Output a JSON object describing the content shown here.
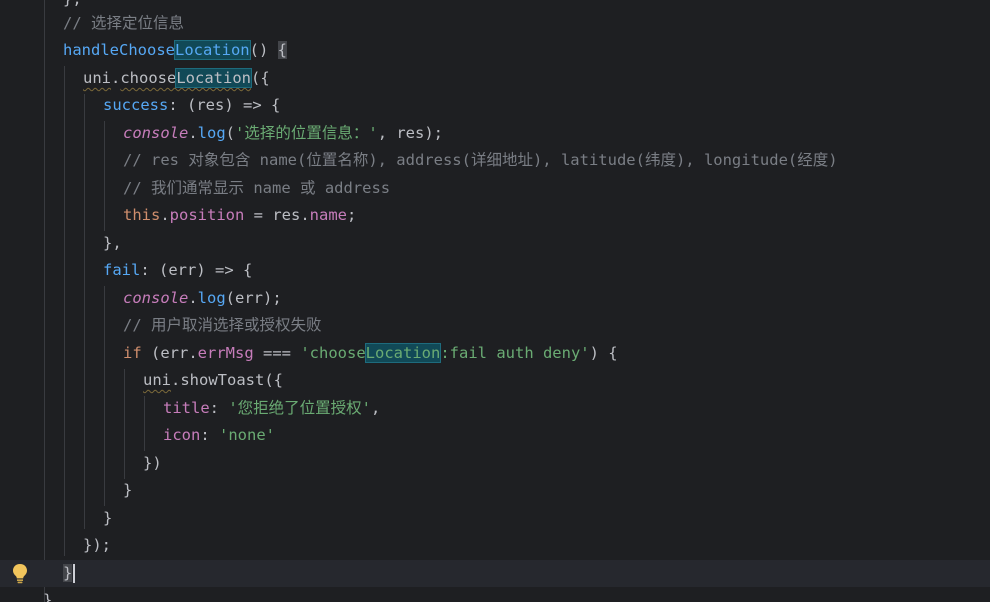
{
  "editor": {
    "lines": {
      "l0": "},",
      "l1": "// 选择定位信息",
      "l2_fn_prefix": "handleChoose",
      "l2_fn_hl": "Location",
      "l2_rest": "() ",
      "l2_brace": "{",
      "l3_obj": "uni",
      "l3_dot": ".",
      "l3_method_prefix": "choose",
      "l3_method_hl": "Location",
      "l3_rest": "({",
      "l4_key": "success",
      "l4_rest": ": (res) => {",
      "l5_console": "console",
      "l5_dot": ".",
      "l5_log": "log",
      "l5_open": "(",
      "l5_str": "'选择的位置信息：'",
      "l5_rest": ", res);",
      "l6_cmt": "// res 对象包含 name(位置名称), address(详细地址), latitude(纬度), longitude(经度)",
      "l7_cmt": "// 我们通常显示 name 或 address",
      "l8_this": "this",
      "l8_dot": ".",
      "l8_prop": "position",
      "l8_mid": " = res.",
      "l8_prop2": "name",
      "l8_end": ";",
      "l9": "},",
      "l10_key": "fail",
      "l10_rest": ": (err) => {",
      "l11_console": "console",
      "l11_dot": ".",
      "l11_log": "log",
      "l11_rest": "(err);",
      "l12_cmt": "// 用户取消选择或授权失败",
      "l13_if": "if",
      "l13_a": " (err.",
      "l13_prop": "errMsg",
      "l13_b": " === ",
      "l13_str_a": "'choose",
      "l13_str_hl": "Location",
      "l13_str_b": ":fail auth deny'",
      "l13_c": ") {",
      "l14_obj": "uni",
      "l14_rest": ".showToast({",
      "l15_key": "title",
      "l15_colon": ": ",
      "l15_str": "'您拒绝了位置授权'",
      "l15_end": ",",
      "l16_key": "icon",
      "l16_colon": ": ",
      "l16_str": "'none'",
      "l17": "})",
      "l18": "}",
      "l19": "}",
      "l20": "});",
      "l21": "}",
      "l22": "},"
    }
  },
  "colors": {
    "background": "#1e1f22",
    "keyword": "#cf8e6d",
    "function": "#56a8f5",
    "property": "#c77dbb",
    "string": "#6aab73",
    "comment": "#7a7e85"
  },
  "icons": {
    "gutter": "lightbulb-icon"
  }
}
